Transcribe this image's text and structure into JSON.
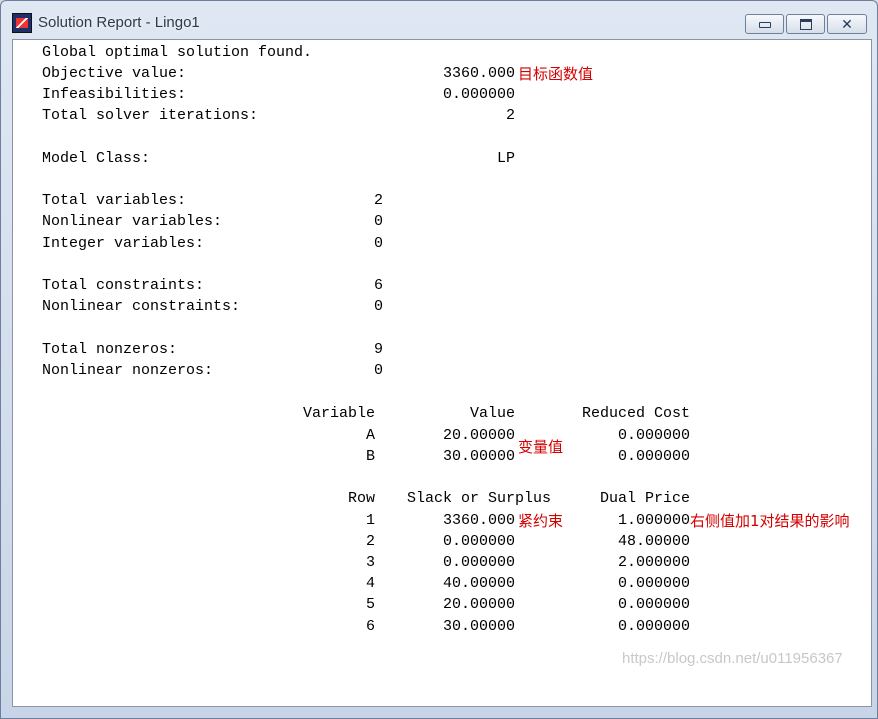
{
  "window": {
    "title": "Solution Report - Lingo1"
  },
  "summary": {
    "status": "Global optimal solution found.",
    "objective_label": "Objective value:",
    "objective_value": "3360.000",
    "infeas_label": "Infeasibilities:",
    "infeas_value": "0.000000",
    "iter_label": "Total solver iterations:",
    "iter_value": "2",
    "model_class_label": "Model Class:",
    "model_class_value": "LP"
  },
  "stats": {
    "total_vars_label": "Total variables:",
    "total_vars": "2",
    "nonlin_vars_label": "Nonlinear variables:",
    "nonlin_vars": "0",
    "int_vars_label": "Integer variables:",
    "int_vars": "0",
    "total_cons_label": "Total constraints:",
    "total_cons": "6",
    "nonlin_cons_label": "Nonlinear constraints:",
    "nonlin_cons": "0",
    "total_nz_label": "Total nonzeros:",
    "total_nz": "9",
    "nonlin_nz_label": "Nonlinear nonzeros:",
    "nonlin_nz": "0"
  },
  "variables": {
    "headers": [
      "Variable",
      "Value",
      "Reduced Cost"
    ],
    "rows": [
      {
        "name": "A",
        "value": "20.00000",
        "reduced_cost": "0.000000"
      },
      {
        "name": "B",
        "value": "30.00000",
        "reduced_cost": "0.000000"
      }
    ]
  },
  "rows_table": {
    "headers": [
      "Row",
      "Slack or Surplus",
      "Dual Price"
    ],
    "rows": [
      {
        "row": "1",
        "slack": "3360.000",
        "dual": "1.000000"
      },
      {
        "row": "2",
        "slack": "0.000000",
        "dual": "48.00000"
      },
      {
        "row": "3",
        "slack": "0.000000",
        "dual": "2.000000"
      },
      {
        "row": "4",
        "slack": "40.00000",
        "dual": "0.000000"
      },
      {
        "row": "5",
        "slack": "20.00000",
        "dual": "0.000000"
      },
      {
        "row": "6",
        "slack": "30.00000",
        "dual": "0.000000"
      }
    ]
  },
  "annotations": {
    "objective": "目标函数值",
    "variables": "变量值",
    "tight": "紧约束",
    "dual": "右侧值加1对结果的影响"
  },
  "watermark": "https://blog.csdn.net/u011956367",
  "colors": {
    "annotation": "#d40000",
    "background": "#ffffff"
  }
}
